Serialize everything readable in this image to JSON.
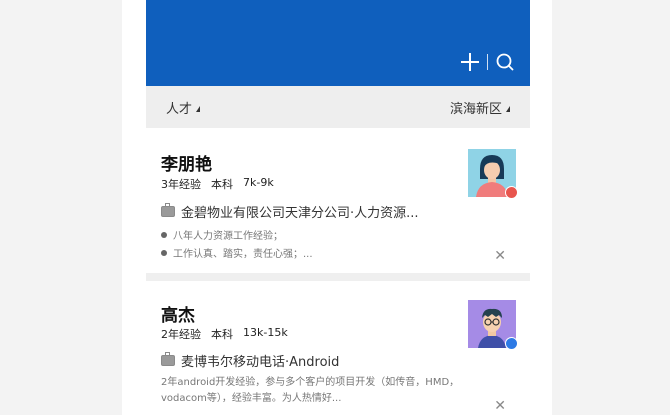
{
  "header": {
    "icons": {
      "add": "plus-icon",
      "search": "search-icon"
    },
    "color": "#0f5fbd"
  },
  "filters": {
    "left": "人才",
    "right": "滨海新区"
  },
  "candidates": [
    {
      "name": "李朋艳",
      "experience": "3年经验",
      "education": "本科",
      "salary": "7k-9k",
      "company": "金碧物业有限公司天津分公司·人力资源...",
      "highlights": [
        "八年人力资源工作经验；",
        "工作认真、踏实，责任心强；..."
      ],
      "badge_color": "#e8554d"
    },
    {
      "name": "高杰",
      "experience": "2年经验",
      "education": "本科",
      "salary": "13k-15k",
      "company": "麦博韦尔移动电话·Android",
      "description": "2年android开发经验，参与多个客户的项目开发（如传音，HMD，vodacom等），经验丰富。为人热情好...",
      "badge_color": "#2d7ae5"
    }
  ]
}
